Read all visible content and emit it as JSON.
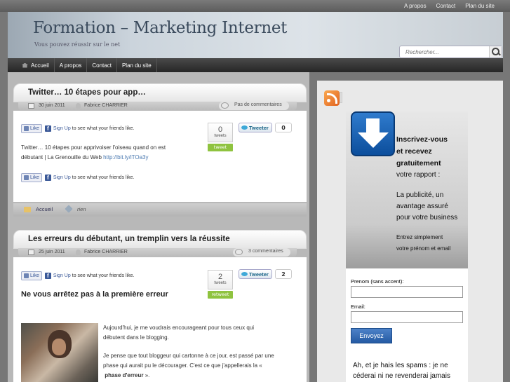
{
  "topnav": [
    "A propos",
    "Contact",
    "Plan du site"
  ],
  "header": {
    "title": "Formation – Marketing Internet",
    "tagline": "Vous pouvez réussir sur le net"
  },
  "search": {
    "placeholder": "Rechercher..."
  },
  "mainnav": [
    "Accueil",
    "A propos",
    "Contact",
    "Plan du site"
  ],
  "post1": {
    "title": "Twitter… 10 étapes pour app…",
    "date": "30 juin 2011",
    "author": "Fabrice CHARRIER",
    "comments": "Pas de commentaires",
    "like": "Like",
    "signup": "Sign Up",
    "like_rest": "to see what your friends like.",
    "tm_count": "0",
    "tm_unit": "tweets",
    "tm_btn": "tweet",
    "tweet_btn": "Tweeter",
    "tweet_count": "0",
    "excerpt_1": "Twitter… 10 étapes pour apprivoiser l'oiseau quand on est",
    "excerpt_2": "débutant | La Grenouille du Web",
    "excerpt_link": "http://bit.ly/iTOa3y",
    "category": "Accueil",
    "tags": "rien"
  },
  "post2": {
    "title": "Les erreurs du débutant, un tremplin vers la réussite",
    "date": "25 juin 2011",
    "author": "Fabrice CHARRIER",
    "comments": "3 commentaires",
    "like": "Like",
    "signup": "Sign Up",
    "like_rest": "to see what your friends like.",
    "tm_count": "2",
    "tm_unit": "tweets",
    "tm_btn": "retweet",
    "tweet_btn": "Tweeter",
    "tweet_count": "2",
    "subheading": "Ne vous arrêtez pas à la première erreur",
    "p1_l1": "Aujourd'hui, je me voudrais encourageant pour tous ceux qui",
    "p1_l2": "débutent dans le blogging.",
    "p2_l1": "Je pense que tout bloggeur qui cartonne à ce jour, est passé par une",
    "p2_l2": "phase qui aurait pu le décourager. C'est ce que j'appellerais la «",
    "p2_l3": "phase d'erreur",
    "p2_l3_end": "»."
  },
  "promo": {
    "t1": "Inscrivez-vous",
    "t2": "et recevez",
    "t3": "gratuitement",
    "n1": "votre rapport :",
    "n2": "La publicité, un",
    "n3": "avantage assuré",
    "n4": "pour votre business",
    "s1": "Entrez simplement",
    "s2": "votre prénom et email"
  },
  "form": {
    "prenom_label": "Prenom (sans accent):",
    "email_label": "Email:",
    "submit": "Envoyez",
    "spam_text": "Ah, et je hais les spams : je ne céderai ni ne revenderai jamais"
  }
}
